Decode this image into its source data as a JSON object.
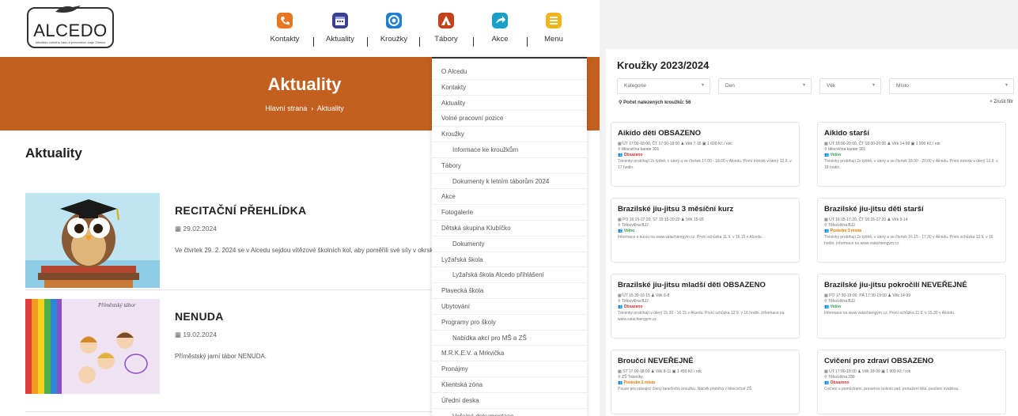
{
  "logo": {
    "brand": "ALCEDO",
    "tagline": "středisko volného času a preventivní kraje Zlínsko"
  },
  "nav": {
    "items": [
      {
        "label": "Kontakty",
        "icon": "contact-icon",
        "color": "#e8761f"
      },
      {
        "label": "Aktuality",
        "icon": "calendar-icon",
        "color": "#3b3f8f"
      },
      {
        "label": "Kroužky",
        "icon": "globe-icon",
        "color": "#1f7fd1"
      },
      {
        "label": "Tábory",
        "icon": "tent-icon",
        "color": "#c2421b"
      },
      {
        "label": "Akce",
        "icon": "arrow-icon",
        "color": "#18a0c6"
      },
      {
        "label": "Menu",
        "icon": "menu-icon",
        "color": "#f2b31b"
      }
    ]
  },
  "hero": {
    "title": "Aktuality",
    "crumb_home": "Hlavní strana",
    "crumb_sep": "›",
    "crumb_current": "Aktuality",
    "color": "#c4601f"
  },
  "section_title": "Aktuality",
  "articles": [
    {
      "title": "RECITAČNÍ PŘEHLÍDKA",
      "date": "29.02.2024",
      "text": "Ve čtvrtek 29. 2. 2024 se v Alcedu sejdou vítězové školních kol, aby poměřili své síly v okrskovém.",
      "thumb_icon": "owl-illustration-icon"
    },
    {
      "title": "NENUDA",
      "date": "19.02.2024",
      "text": "Příměstský jarní tábor NENUDA.",
      "thumb_caption": "Příměstský tábor",
      "thumb_icon": "children-illustration-icon"
    }
  ],
  "dropdown": {
    "items": [
      {
        "label": "O Alcedu",
        "sub": false
      },
      {
        "label": "Kontakty",
        "sub": false
      },
      {
        "label": "Aktuality",
        "sub": false
      },
      {
        "label": "Volné pracovní pozice",
        "sub": false
      },
      {
        "label": "Kroužky",
        "sub": false
      },
      {
        "label": "Informace ke kroužkům",
        "sub": true
      },
      {
        "label": "Tábory",
        "sub": false
      },
      {
        "label": "Dokumenty k letním táborům 2024",
        "sub": true
      },
      {
        "label": "Akce",
        "sub": false
      },
      {
        "label": "Fotogalerie",
        "sub": false
      },
      {
        "label": "Dětská skupina Klubíčko",
        "sub": false
      },
      {
        "label": "Dokumenty",
        "sub": true
      },
      {
        "label": "Lyžařská škola",
        "sub": false
      },
      {
        "label": "Lyžařská škola Alcedo přihlášení",
        "sub": true
      },
      {
        "label": "Plavecká škola",
        "sub": false
      },
      {
        "label": "Ubytování",
        "sub": false
      },
      {
        "label": "Programy pro školy",
        "sub": false
      },
      {
        "label": "Nabídka akcí pro MŠ a ZŠ",
        "sub": true
      },
      {
        "label": "M.R.K.E.V. a Mrkvička",
        "sub": false
      },
      {
        "label": "Pronájmy",
        "sub": false
      },
      {
        "label": "Klientská zóna",
        "sub": false
      },
      {
        "label": "Úřední deska",
        "sub": false
      },
      {
        "label": "Veřejná dokumentace",
        "sub": true
      }
    ]
  },
  "krouzky": {
    "title": "Kroužky 2023/2024",
    "filters": [
      {
        "label": "Kategorie"
      },
      {
        "label": "Den"
      },
      {
        "label": "Věk"
      },
      {
        "label": "Místo"
      }
    ],
    "count_label": "Počet nalezených kroužků: 56",
    "clear_label": "× Zrušit filtr",
    "cards": [
      {
        "title": "Aikido děti OBSAZENO",
        "meta": "▦ ÚT 17:00-18:00, ČT 17:00-18:00   ♟ Věk 7-15   ▣ 1 600 Kč / rok",
        "place": "⚲ tělocvična karate 301",
        "status": "Obsazeno",
        "status_class": "st-red",
        "desc": "Tréninky probíhají 2x týdně, v úterý a ve čtvrtek 17.00 - 18.00 v Alcedu. První trénink v úterý 12.9. v 17 hodin."
      },
      {
        "title": "Aikido starší",
        "meta": "▦ ÚT 18:00-20:00, ČT 18:00-20:00   ♟ Věk 14-99   ▣ 1 900 Kč / rok",
        "place": "⚲ tělocvična karate 301",
        "status": "Volno",
        "status_class": "st-green",
        "desc": "Tréninky probíhají 2x týdně, v úterý a ve čtvrtek 18.00 - 20.00 v Alcedu. První trénink v úterý 12.9. v 18 hodin."
      },
      {
        "title": "Brazilské jiu-jitsu 3 měsíční kurz",
        "meta": "▦ PO 16:15-17:20, ST 19:15-20:20   ♟ Věk 15-99",
        "place": "⚲ Tělocvična BJJ",
        "status": "Volno",
        "status_class": "st-green",
        "desc": "Informace o kurzu na www.valachiengym.cz. První schůzka 11.9. v 16.15 v Alcedu."
      },
      {
        "title": "Brazilské jiu-jitsu děti starší",
        "meta": "▦ ÚT 16:15-17:20, ČT 16:15-17:20   ♟ Věk 9-14",
        "place": "⚲ Tělocvična BJJ",
        "status": "Poslední 3 místa",
        "status_class": "st-orange",
        "desc": "Tréninky probíhají 2x týdně, v úterý a ve čtvrtek 16.15 - 17.30 v Alcedu. První schůzka 12.9. v 16 hodin. Informace na www.valachiengym.cz"
      },
      {
        "title": "Brazilské jiu-jitsu mladší děti OBSAZENO",
        "meta": "▦ ÚT 15:30-16:15   ♟ Věk 6-8",
        "place": "⚲ Tělocvična BJJ",
        "status": "Obsazeno",
        "status_class": "st-red",
        "desc": "Tréninky probíhají v úterý 15.30 - 16.15 v Alcedu. První schůzka 12.9. v 16 hodin. Informace na www.valachiengym.cz"
      },
      {
        "title": "Brazilské jiu-jitsu pokročilí NEVEŘEJNÉ",
        "meta": "▦ PO 17:30-19:00, PÁ 17:30-19:00   ♟ Věk 14-99",
        "place": "⚲ Tělocvična BJJ",
        "status": "Volno",
        "status_class": "st-green",
        "desc": "Informace na www.valachiengym.cz. První schůzka 11.9. v 15.30 v Alcedu."
      },
      {
        "title": "Broučci NEVEŘEJNÉ",
        "meta": "▦ ST 17:00-18:00   ♟ Věk 8-11   ▣ 1 450 Kč / rok",
        "place": "⚲ ZŠ Trávníky",
        "status": "Poslední 2 místa",
        "status_class": "st-orange",
        "desc": "Pouze pro stávající členy tanečního kroužku. Nácvik probíhá v tělocvičně ZŠ"
      },
      {
        "title": "Cvičení pro zdraví OBSAZENO",
        "meta": "▦ ÚT 17:00-18:00   ♟ Věk 18-99   ▣ 1 900 Kč / rok",
        "place": "⚲ Tělocvična 230",
        "status": "Obsazeno",
        "status_class": "st-red",
        "desc": "Cvičení s pomůckami, prevence bolesti zad, protažení těla, posílení svalstva."
      }
    ]
  }
}
